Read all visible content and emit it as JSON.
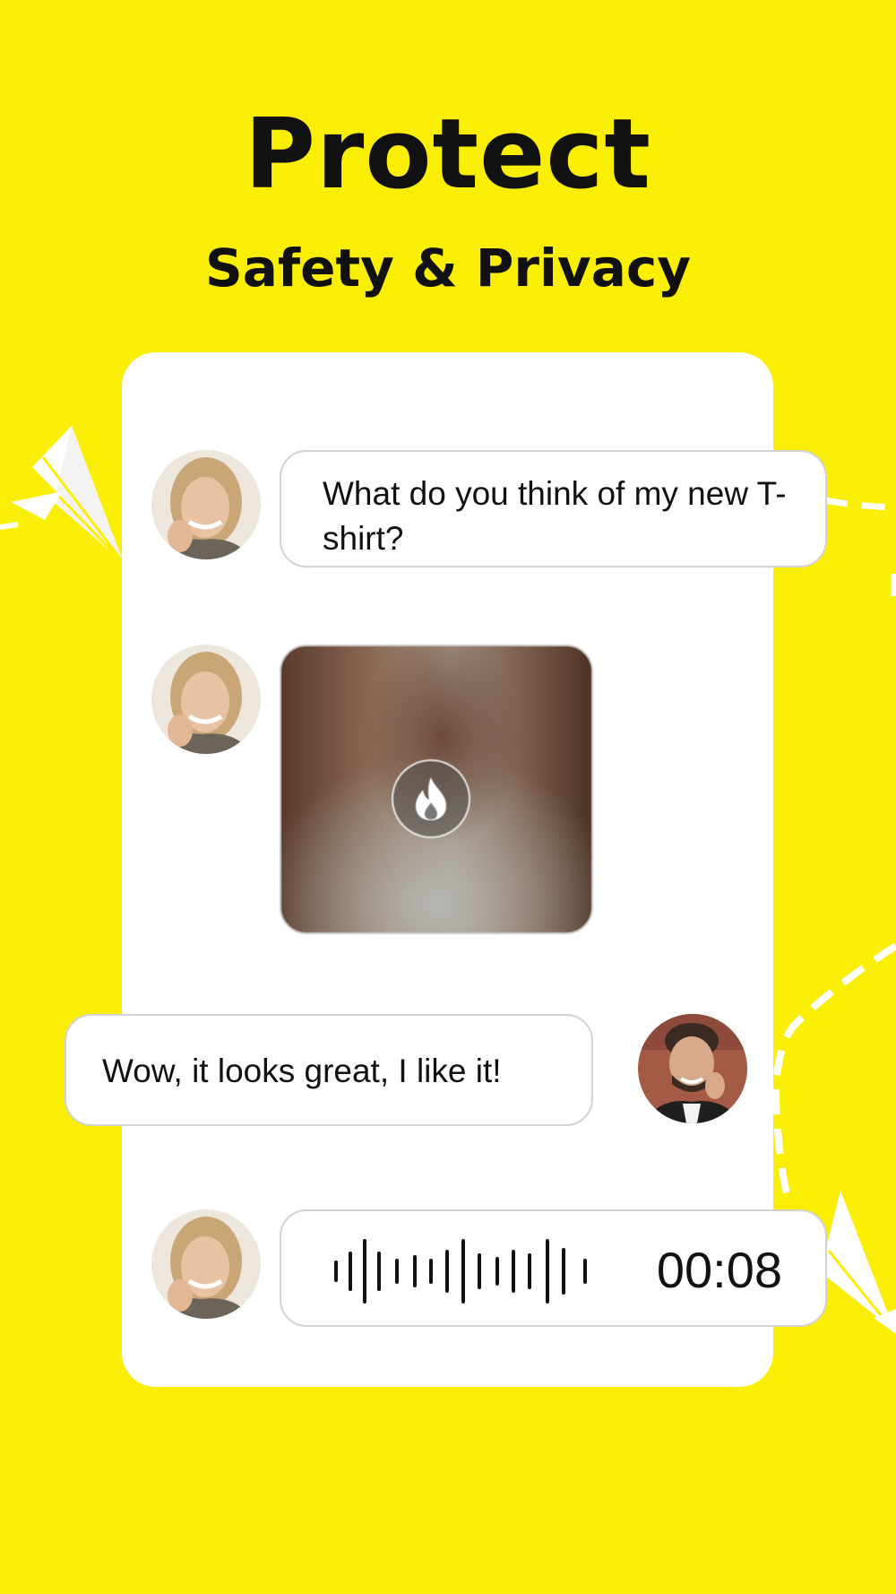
{
  "header": {
    "title": "Protect",
    "subtitle": "Safety & Privacy"
  },
  "chat": {
    "messages": [
      {
        "sender": "her",
        "type": "text",
        "text": "What do you think of my new T-shirt?"
      },
      {
        "sender": "her",
        "type": "photo",
        "icon": "flame-icon",
        "state": "burn-after-reading blurred"
      },
      {
        "sender": "him",
        "type": "text",
        "text": "Wow, it looks great, I like it!"
      },
      {
        "sender": "her",
        "type": "voice",
        "duration": "00:08",
        "icon": "voice-waveform-icon"
      }
    ]
  },
  "colors": {
    "background": "#FAEE05",
    "card": "#FFFFFF",
    "text": "#111111",
    "bubble_border": "#D2D2D2"
  }
}
